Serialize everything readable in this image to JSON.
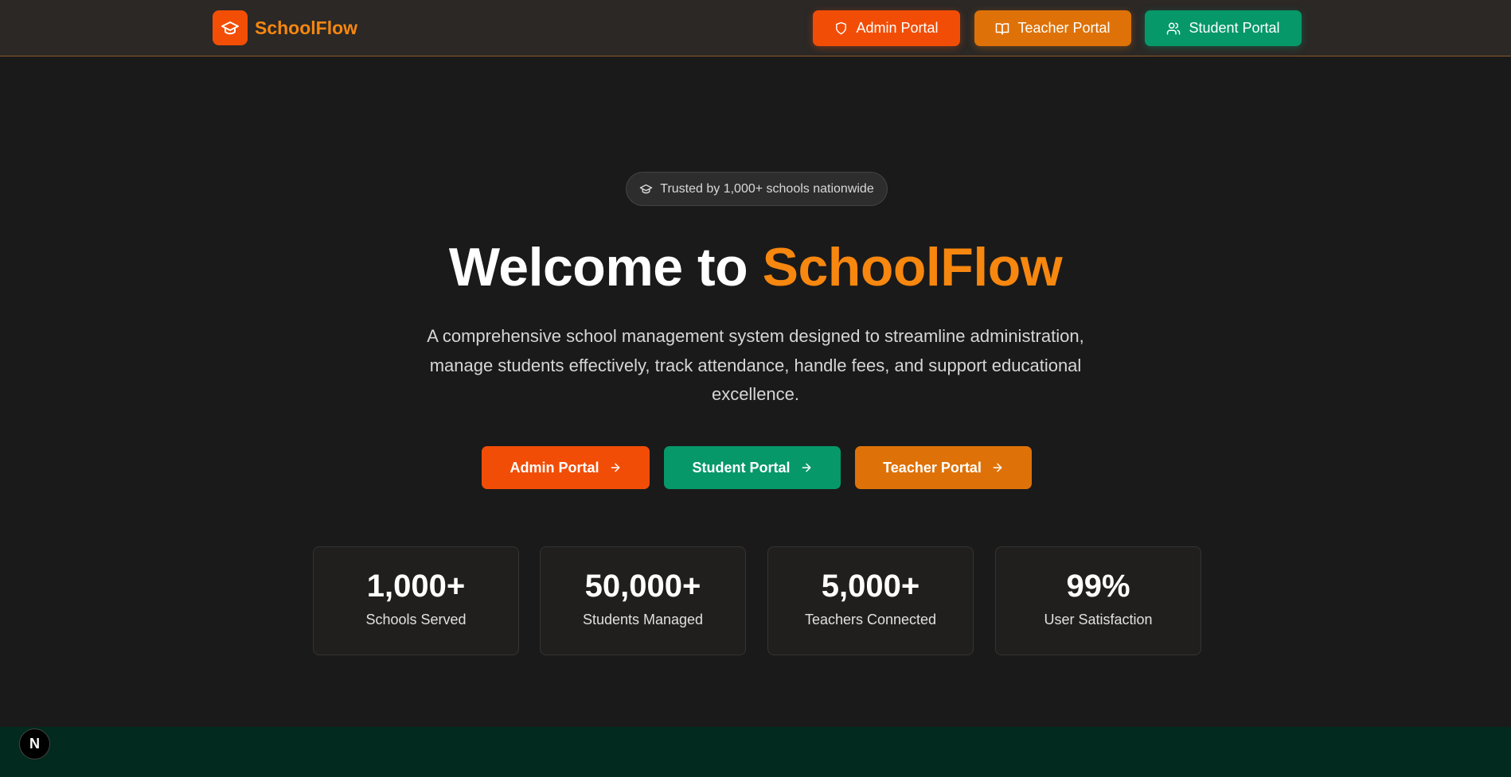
{
  "brand": {
    "name": "SchoolFlow",
    "icon": "graduation-cap-icon"
  },
  "nav": {
    "admin_label": "Admin Portal",
    "teacher_label": "Teacher Portal",
    "student_label": "Student Portal"
  },
  "hero": {
    "badge_text": "Trusted by 1,000+ schools nationwide",
    "title_prefix": "Welcome to ",
    "title_accent": "SchoolFlow",
    "description": "A comprehensive school management system designed to streamline administration, manage students effectively, track attendance, handle fees, and support educational excellence."
  },
  "cta": {
    "admin_label": "Admin Portal",
    "student_label": "Student Portal",
    "teacher_label": "Teacher Portal"
  },
  "stats": [
    {
      "value": "1,000+",
      "label": "Schools Served"
    },
    {
      "value": "50,000+",
      "label": "Students Managed"
    },
    {
      "value": "5,000+",
      "label": "Teachers Connected"
    },
    {
      "value": "99%",
      "label": "User Satisfaction"
    }
  ],
  "dev_badge": "N",
  "colors": {
    "background": "#1a1a1a",
    "accent_orange": "#f7870f",
    "admin_red_orange": "#f24d06",
    "teacher_orange": "#de7208",
    "student_green": "#069869"
  }
}
